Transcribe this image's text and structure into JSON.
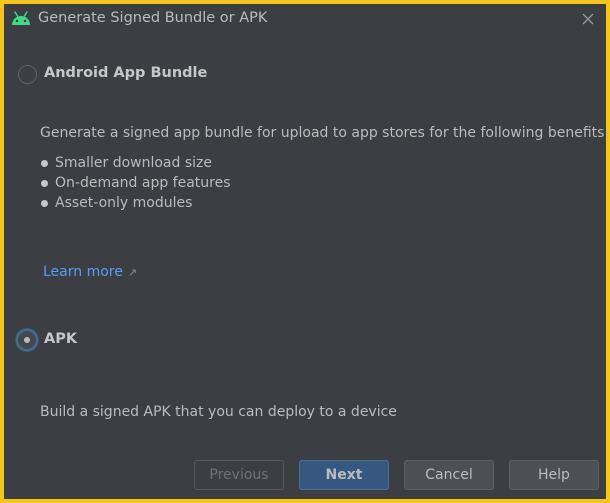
{
  "window": {
    "title": "Generate Signed Bundle or APK",
    "icon": "android-icon",
    "close_icon": "close-icon"
  },
  "options": {
    "bundle": {
      "label": "Android App Bundle",
      "selected": false,
      "description": "Generate a signed app bundle for upload to app stores for the following benefits:",
      "benefits": [
        "Smaller download size",
        "On-demand app features",
        "Asset-only modules"
      ],
      "learn_more": "Learn more",
      "learn_more_icon": "external-link-icon"
    },
    "apk": {
      "label": "APK",
      "selected": true,
      "description": "Build a signed APK that you can deploy to a device"
    }
  },
  "buttons": {
    "previous": "Previous",
    "next": "Next",
    "cancel": "Cancel",
    "help": "Help"
  },
  "colors": {
    "background": "#3c3f41",
    "link": "#589df6",
    "primary_button": "#365880",
    "android_green": "#3ddc84",
    "frame": "#f5c518"
  }
}
